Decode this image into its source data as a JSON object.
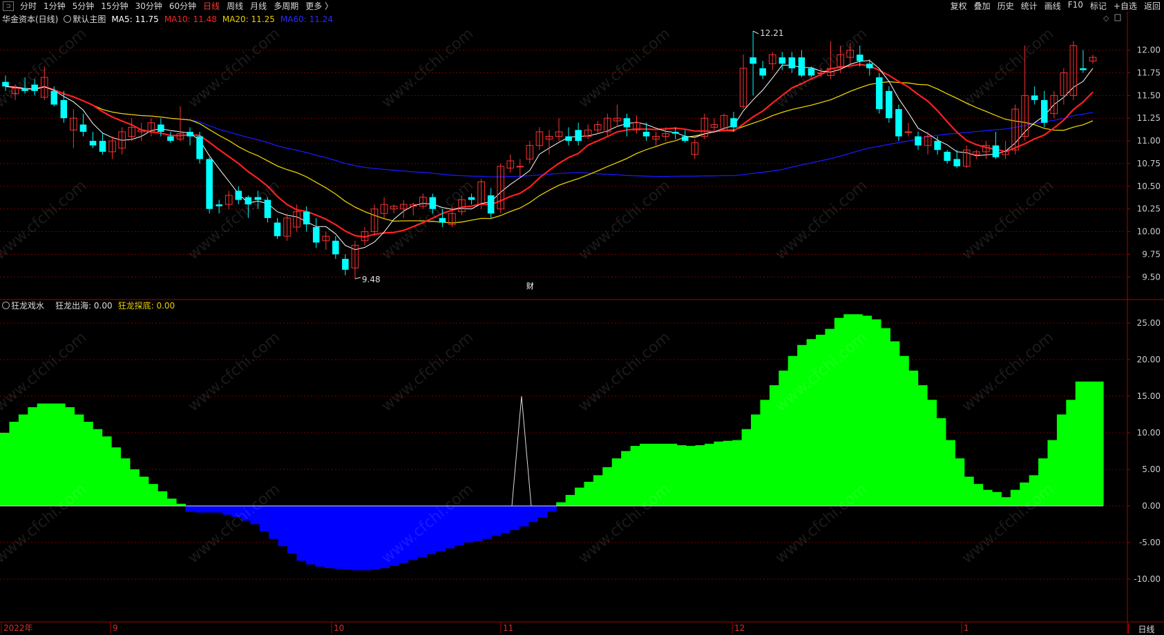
{
  "toolbar": {
    "periods": [
      "分时",
      "1分钟",
      "5分钟",
      "15分钟",
      "30分钟",
      "60分钟",
      "日线",
      "周线",
      "月线",
      "多周期",
      "更多 〉"
    ],
    "active_period": "日线",
    "right_items": [
      "复权",
      "叠加",
      "历史",
      "统计",
      "画线",
      "F10",
      "标记",
      "+自选",
      "返回"
    ]
  },
  "main_legend": {
    "title": "华金资本(日线)",
    "template": "默认主图",
    "ma5": "MA5: 11.75",
    "ma10": "MA10: 11.48",
    "ma20": "MA20: 11.25",
    "ma60": "MA60: 11.24"
  },
  "sub_legend": {
    "title": "狂龙戏水",
    "line1": "狂龙出海: 0.00",
    "line2": "狂龙探底: 0.00"
  },
  "annotations": {
    "high": "12.21",
    "low": "9.48",
    "event": "财"
  },
  "price_axis": [
    "12.00",
    "11.75",
    "11.50",
    "11.25",
    "11.00",
    "10.75",
    "10.50",
    "10.25",
    "10.00",
    "9.75",
    "9.50"
  ],
  "indicator_axis": [
    "25.00",
    "20.00",
    "15.00",
    "10.00",
    "5.00",
    "0.00",
    "-5.00",
    "-10.00"
  ],
  "time_axis": [
    "2022年",
    "9",
    "10",
    "11",
    "12",
    "1"
  ],
  "bottom_tab": "日线",
  "watermark": "www.cfchi.com",
  "colors": {
    "up": "#ff3232",
    "down": "#00ffff",
    "ma5": "#ffffff",
    "ma10": "#ff2020",
    "ma20": "#e8d000",
    "ma60": "#1818ff",
    "pos": "#00ff00",
    "neg": "#0000ff",
    "grid": "#7a0000"
  },
  "chart_data": [
    {
      "type": "candlestick",
      "title": "华金资本(日线)",
      "candles": [
        [
          11.65,
          11.72,
          11.55,
          11.6
        ],
        [
          11.52,
          11.62,
          11.45,
          11.58
        ],
        [
          11.58,
          11.7,
          11.52,
          11.55
        ],
        [
          11.62,
          11.68,
          11.5,
          11.55
        ],
        [
          11.48,
          11.82,
          11.45,
          11.7
        ],
        [
          11.55,
          11.6,
          11.38,
          11.4
        ],
        [
          11.45,
          11.55,
          11.2,
          11.25
        ],
        [
          11.12,
          11.35,
          10.92,
          11.25
        ],
        [
          11.18,
          11.3,
          11.05,
          11.1
        ],
        [
          11.0,
          11.1,
          10.92,
          10.95
        ],
        [
          11.0,
          11.08,
          10.85,
          10.88
        ],
        [
          10.88,
          11.05,
          10.8,
          11.0
        ],
        [
          10.92,
          11.15,
          10.85,
          11.1
        ],
        [
          11.05,
          11.25,
          11.0,
          11.15
        ],
        [
          11.1,
          11.2,
          11.0,
          11.12
        ],
        [
          11.1,
          11.25,
          11.05,
          11.2
        ],
        [
          11.18,
          11.25,
          11.05,
          11.1
        ],
        [
          11.05,
          11.1,
          10.98,
          11.0
        ],
        [
          11.02,
          11.38,
          11.0,
          11.08
        ],
        [
          11.1,
          11.15,
          10.95,
          11.05
        ],
        [
          11.05,
          11.1,
          10.75,
          10.8
        ],
        [
          10.8,
          10.82,
          10.2,
          10.25
        ],
        [
          10.3,
          10.35,
          10.2,
          10.28
        ],
        [
          10.3,
          10.45,
          10.25,
          10.4
        ],
        [
          10.45,
          10.5,
          10.3,
          10.35
        ],
        [
          10.38,
          10.4,
          10.15,
          10.3
        ],
        [
          10.38,
          10.45,
          10.25,
          10.35
        ],
        [
          10.35,
          10.38,
          10.1,
          10.15
        ],
        [
          10.1,
          10.15,
          9.92,
          9.95
        ],
        [
          9.95,
          10.2,
          9.9,
          10.15
        ],
        [
          10.05,
          10.3,
          10.0,
          10.22
        ],
        [
          10.22,
          10.28,
          10.0,
          10.08
        ],
        [
          10.05,
          10.15,
          9.82,
          9.88
        ],
        [
          9.9,
          10.0,
          9.8,
          9.95
        ],
        [
          9.9,
          9.95,
          9.7,
          9.75
        ],
        [
          9.7,
          9.75,
          9.52,
          9.58
        ],
        [
          9.6,
          9.9,
          9.48,
          9.85
        ],
        [
          9.9,
          10.05,
          9.85,
          10.0
        ],
        [
          10.0,
          10.3,
          9.95,
          10.25
        ],
        [
          10.2,
          10.38,
          10.15,
          10.3
        ],
        [
          10.25,
          10.3,
          10.2,
          10.28
        ],
        [
          10.25,
          10.35,
          10.15,
          10.3
        ],
        [
          10.28,
          10.32,
          10.18,
          10.3
        ],
        [
          10.28,
          10.42,
          10.25,
          10.38
        ],
        [
          10.38,
          10.42,
          10.2,
          10.25
        ],
        [
          10.15,
          10.25,
          10.05,
          10.1
        ],
        [
          10.08,
          10.28,
          10.05,
          10.2
        ],
        [
          10.22,
          10.4,
          10.18,
          10.35
        ],
        [
          10.38,
          10.42,
          10.3,
          10.35
        ],
        [
          10.3,
          10.58,
          10.25,
          10.55
        ],
        [
          10.4,
          10.48,
          10.15,
          10.2
        ],
        [
          10.25,
          10.75,
          10.2,
          10.72
        ],
        [
          10.7,
          10.85,
          10.65,
          10.78
        ],
        [
          10.72,
          10.8,
          10.6,
          10.72
        ],
        [
          10.8,
          11.0,
          10.75,
          10.95
        ],
        [
          10.95,
          11.15,
          10.9,
          11.1
        ],
        [
          11.02,
          11.12,
          10.85,
          11.05
        ],
        [
          11.05,
          11.25,
          11.0,
          11.1
        ],
        [
          11.05,
          11.15,
          10.95,
          11.0
        ],
        [
          11.12,
          11.2,
          10.95,
          11.0
        ],
        [
          11.05,
          11.18,
          11.02,
          11.12
        ],
        [
          11.12,
          11.22,
          11.08,
          11.18
        ],
        [
          11.1,
          11.3,
          11.05,
          11.25
        ],
        [
          11.22,
          11.4,
          11.15,
          11.25
        ],
        [
          11.25,
          11.3,
          11.05,
          11.15
        ],
        [
          11.12,
          11.28,
          11.08,
          11.2
        ],
        [
          11.1,
          11.2,
          11.0,
          11.05
        ],
        [
          11.02,
          11.1,
          10.95,
          11.05
        ],
        [
          11.05,
          11.15,
          11.0,
          11.08
        ],
        [
          11.1,
          11.15,
          11.02,
          11.08
        ],
        [
          11.05,
          11.12,
          10.98,
          11.0
        ],
        [
          10.85,
          11.02,
          10.8,
          10.98
        ],
        [
          11.05,
          11.3,
          11.02,
          11.25
        ],
        [
          11.15,
          11.25,
          11.1,
          11.18
        ],
        [
          11.12,
          11.3,
          11.1,
          11.28
        ],
        [
          11.25,
          11.32,
          11.1,
          11.15
        ],
        [
          11.38,
          11.95,
          11.35,
          11.8
        ],
        [
          11.92,
          12.21,
          11.5,
          11.85
        ],
        [
          11.8,
          11.88,
          11.68,
          11.72
        ],
        [
          11.85,
          11.98,
          11.78,
          11.95
        ],
        [
          11.92,
          11.98,
          11.78,
          11.85
        ],
        [
          11.92,
          11.98,
          11.75,
          11.8
        ],
        [
          11.92,
          12.0,
          11.7,
          11.72
        ],
        [
          11.8,
          11.82,
          11.7,
          11.72
        ],
        [
          11.75,
          11.8,
          11.7,
          11.75
        ],
        [
          11.72,
          12.1,
          11.68,
          11.8
        ],
        [
          11.82,
          12.05,
          11.75,
          11.95
        ],
        [
          11.92,
          12.08,
          11.85,
          12.0
        ],
        [
          11.95,
          12.05,
          11.82,
          11.88
        ],
        [
          11.85,
          11.9,
          11.72,
          11.8
        ],
        [
          11.7,
          11.75,
          11.3,
          11.35
        ],
        [
          11.55,
          11.6,
          11.2,
          11.25
        ],
        [
          11.35,
          11.4,
          11.0,
          11.05
        ],
        [
          11.1,
          11.2,
          11.05,
          11.1
        ],
        [
          11.05,
          11.1,
          10.9,
          10.95
        ],
        [
          10.95,
          11.1,
          10.85,
          11.05
        ],
        [
          11.0,
          11.05,
          10.85,
          10.9
        ],
        [
          10.88,
          10.9,
          10.75,
          10.78
        ],
        [
          10.8,
          10.9,
          10.7,
          10.72
        ],
        [
          10.72,
          10.95,
          10.7,
          10.9
        ],
        [
          10.85,
          10.9,
          10.8,
          10.88
        ],
        [
          10.88,
          11.0,
          10.8,
          10.95
        ],
        [
          10.95,
          11.1,
          10.8,
          10.82
        ],
        [
          10.85,
          11.0,
          10.8,
          10.88
        ],
        [
          10.9,
          11.4,
          10.85,
          11.35
        ],
        [
          11.05,
          12.05,
          11.0,
          11.5
        ],
        [
          11.5,
          11.6,
          11.4,
          11.45
        ],
        [
          11.45,
          11.55,
          11.15,
          11.2
        ],
        [
          11.3,
          11.55,
          11.25,
          11.5
        ],
        [
          11.5,
          11.8,
          11.4,
          11.75
        ],
        [
          11.5,
          12.1,
          11.45,
          12.05
        ],
        [
          11.8,
          12.0,
          11.75,
          11.78
        ],
        [
          11.88,
          11.95,
          11.85,
          11.92
        ]
      ]
    },
    {
      "type": "area",
      "title": "狂龙戏水",
      "ylim": [
        -12,
        27
      ],
      "values": [
        10,
        11.5,
        12.5,
        13.5,
        14,
        14,
        14,
        13.5,
        12.5,
        11.5,
        10.5,
        9.5,
        8,
        6.5,
        5,
        4,
        3,
        2,
        1,
        0.3,
        -0.8,
        -0.9,
        -0.9,
        -0.9,
        -1.2,
        -1.5,
        -2,
        -2.5,
        -3.5,
        -4.5,
        -5.5,
        -6.5,
        -7.5,
        -8,
        -8.3,
        -8.5,
        -8.6,
        -8.7,
        -8.8,
        -8.8,
        -8.7,
        -8.5,
        -8.2,
        -7.8,
        -7.4,
        -7,
        -6.6,
        -6.2,
        -5.8,
        -5.4,
        -5.0,
        -4.8,
        -4.5,
        -4.1,
        -3.7,
        -3.3,
        -2.8,
        -2.2,
        -1.6,
        -0.8,
        0.5,
        1.5,
        2.5,
        3.3,
        4.2,
        5.3,
        6.5,
        7.5,
        8.2,
        8.5,
        8.5,
        8.5,
        8.5,
        8.3,
        8.2,
        8.3,
        8.5,
        8.8,
        8.9,
        9,
        10.5,
        12.5,
        14.5,
        16.5,
        18.5,
        20.5,
        22,
        22.8,
        23.4,
        24.2,
        25.7,
        26.2,
        26.2,
        26,
        25.5,
        24.3,
        22.5,
        20.5,
        18.5,
        16.5,
        14.5,
        12,
        9,
        6.5,
        4,
        3,
        2.2,
        1.9,
        1.2,
        2.2,
        3.2,
        4.2,
        6.5,
        9,
        12.5,
        14.5,
        17,
        17,
        17
      ],
      "spike": {
        "index": 50,
        "value": 15
      }
    }
  ]
}
